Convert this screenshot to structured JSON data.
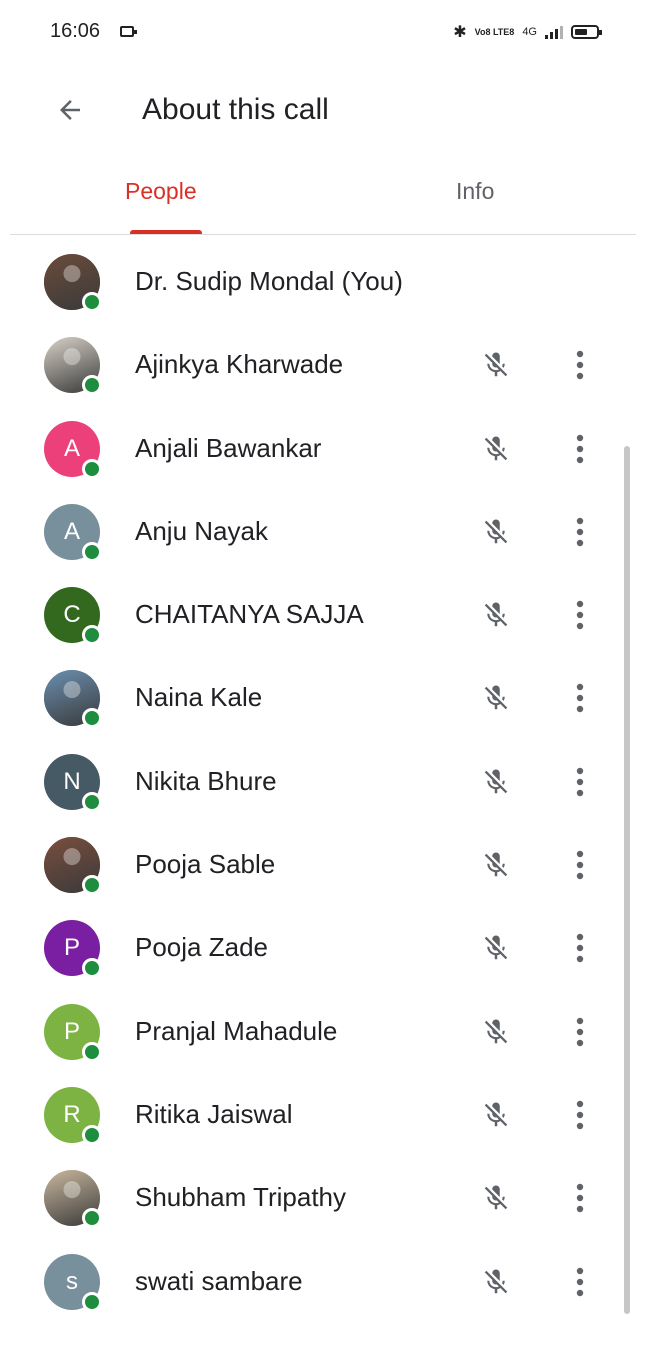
{
  "status_bar": {
    "time": "16:06",
    "bluetooth_icon": "bluetooth-icon",
    "volte_label": "Vo8 LTE8",
    "network_label": "4G"
  },
  "app_bar": {
    "title": "About this call",
    "back_icon": "arrow-back-icon"
  },
  "tabs": [
    {
      "label": "People",
      "selected": true
    },
    {
      "label": "Info",
      "selected": false
    }
  ],
  "colors": {
    "accent": "#d93025",
    "presence": "#1e8e3e",
    "muted_icon": "#5f6368"
  },
  "participants": [
    {
      "name": "Dr. Sudip Mondal (You)",
      "avatar_type": "photo",
      "avatar_letter": "",
      "avatar_color": "#6b4c3b",
      "muted": false,
      "more": false
    },
    {
      "name": "Ajinkya Kharwade",
      "avatar_type": "photo",
      "avatar_letter": "",
      "avatar_color": "#d8d2c8",
      "muted": true,
      "more": true
    },
    {
      "name": "Anjali Bawankar",
      "avatar_type": "letter",
      "avatar_letter": "A",
      "avatar_color": "#ec407a",
      "muted": true,
      "more": true
    },
    {
      "name": "Anju Nayak",
      "avatar_type": "letter",
      "avatar_letter": "A",
      "avatar_color": "#78909c",
      "muted": true,
      "more": true
    },
    {
      "name": "CHAITANYA SAJJA",
      "avatar_type": "letter",
      "avatar_letter": "C",
      "avatar_color": "#33691e",
      "muted": true,
      "more": true
    },
    {
      "name": "Naina Kale",
      "avatar_type": "photo",
      "avatar_letter": "",
      "avatar_color": "#6b8fb0",
      "muted": true,
      "more": true
    },
    {
      "name": "Nikita Bhure",
      "avatar_type": "letter",
      "avatar_letter": "N",
      "avatar_color": "#455a64",
      "muted": true,
      "more": true
    },
    {
      "name": "Pooja Sable",
      "avatar_type": "photo",
      "avatar_letter": "",
      "avatar_color": "#7a4e3e",
      "muted": true,
      "more": true
    },
    {
      "name": "Pooja Zade",
      "avatar_type": "letter",
      "avatar_letter": "P",
      "avatar_color": "#7b1fa2",
      "muted": true,
      "more": true
    },
    {
      "name": "Pranjal Mahadule",
      "avatar_type": "letter",
      "avatar_letter": "P",
      "avatar_color": "#7cb342",
      "muted": true,
      "more": true
    },
    {
      "name": "Ritika Jaiswal",
      "avatar_type": "letter",
      "avatar_letter": "R",
      "avatar_color": "#7cb342",
      "muted": true,
      "more": true
    },
    {
      "name": "Shubham Tripathy",
      "avatar_type": "photo",
      "avatar_letter": "",
      "avatar_color": "#c9b89e",
      "muted": true,
      "more": true
    },
    {
      "name": "swati sambare",
      "avatar_type": "letter",
      "avatar_letter": "s",
      "avatar_color": "#78909c",
      "muted": true,
      "more": true
    }
  ]
}
